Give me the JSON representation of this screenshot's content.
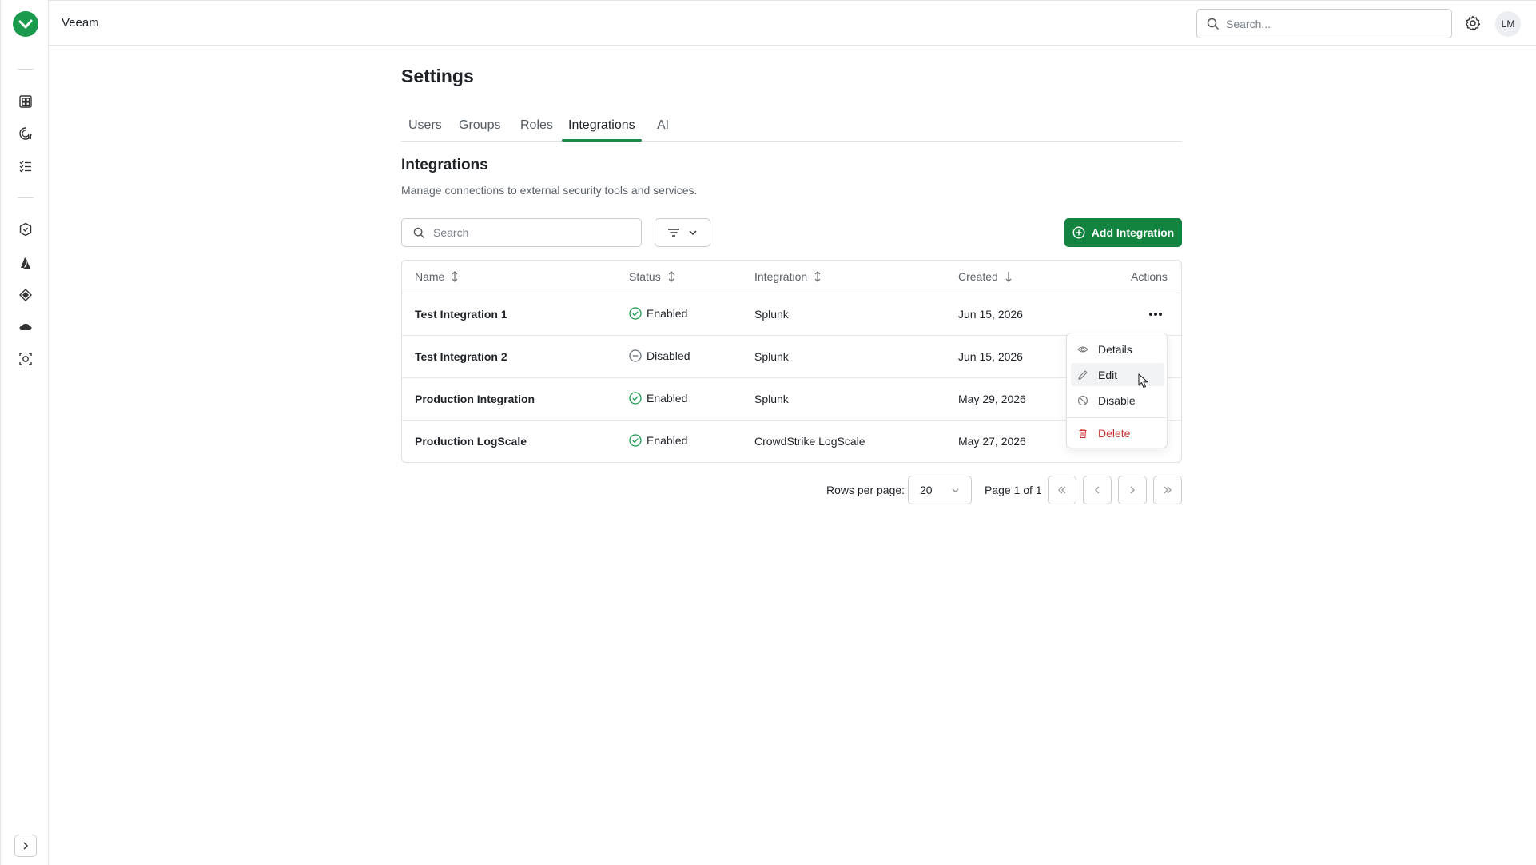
{
  "app": {
    "name": "Veeam"
  },
  "header": {
    "search_placeholder": "Search...",
    "avatar_initials": "LM"
  },
  "page": {
    "title": "Settings"
  },
  "tabs": [
    {
      "label": "Users"
    },
    {
      "label": "Groups"
    },
    {
      "label": "Roles"
    },
    {
      "label": "Integrations",
      "active": true
    },
    {
      "label": "AI"
    }
  ],
  "section": {
    "title": "Integrations",
    "subtitle": "Manage connections to external security tools and services."
  },
  "toolbar": {
    "search_placeholder": "Search",
    "add_label": "Add Integration"
  },
  "table": {
    "columns": {
      "name": "Name",
      "status": "Status",
      "integration": "Integration",
      "created": "Created",
      "actions": "Actions"
    },
    "rows": [
      {
        "name": "Test Integration 1",
        "status": "Enabled",
        "integration": "Splunk",
        "created": "Jun 15, 2026"
      },
      {
        "name": "Test Integration 2",
        "status": "Disabled",
        "integration": "Splunk",
        "created": "Jun 15, 2026"
      },
      {
        "name": "Production Integration",
        "status": "Enabled",
        "integration": "Splunk",
        "created": "May 29, 2026"
      },
      {
        "name": "Production LogScale",
        "status": "Enabled",
        "integration": "CrowdStrike LogScale",
        "created": "May 27, 2026"
      }
    ]
  },
  "menu": {
    "details": "Details",
    "edit": "Edit",
    "disable": "Disable",
    "delete": "Delete"
  },
  "pagination": {
    "rows_per_page_label": "Rows per page:",
    "rows_per_page": "20",
    "page_info": "Page 1 of 1"
  },
  "colors": {
    "brand": "#1a9a4c",
    "primary_button": "#12843f",
    "enabled": "#1a9a4c",
    "danger": "#c8322f"
  }
}
